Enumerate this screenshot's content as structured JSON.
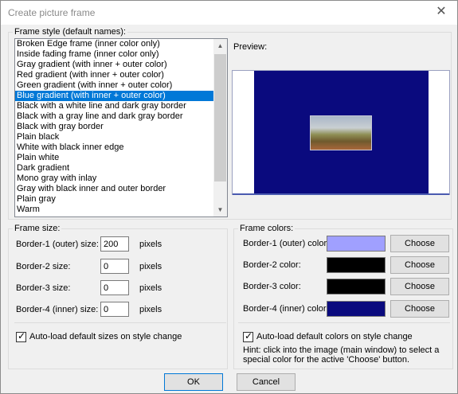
{
  "window": {
    "title": "Create picture frame"
  },
  "frame_style": {
    "legend": "Frame style (default names):",
    "items": [
      "Broken Edge frame (inner color only)",
      "Inside fading frame (inner color only)",
      "Gray gradient (with inner + outer color)",
      "Red gradient (with inner + outer color)",
      "Green gradient (with inner + outer color)",
      "Blue gradient (with inner + outer color)",
      "Black with a white line and dark gray border",
      "Black with a gray line and dark gray border",
      "Black with gray border",
      "Plain black",
      "White with black inner edge",
      "Plain white",
      "Dark gradient",
      "Mono gray with inlay",
      "Gray with black inner and outer border",
      "Plain gray",
      "Warm"
    ],
    "selected_index": 5
  },
  "preview": {
    "label": "Preview:"
  },
  "frame_size": {
    "legend": "Frame size:",
    "unit": "pixels",
    "rows": [
      {
        "label": "Border-1 (outer) size:",
        "value": "200"
      },
      {
        "label": "Border-2 size:",
        "value": "0"
      },
      {
        "label": "Border-3 size:",
        "value": "0"
      },
      {
        "label": "Border-4 (inner) size:",
        "value": "0"
      }
    ],
    "autoload_label": "Auto-load default sizes on style change",
    "autoload_checked": true
  },
  "frame_colors": {
    "legend": "Frame colors:",
    "choose_label": "Choose",
    "rows": [
      {
        "label": "Border-1 (outer) color:",
        "color": "#a0a0ff"
      },
      {
        "label": "Border-2 color:",
        "color": "#000000"
      },
      {
        "label": "Border-3 color:",
        "color": "#000000"
      },
      {
        "label": "Border-4 (inner) color:",
        "color": "#0a0a7e"
      }
    ],
    "autoload_label": "Auto-load default colors on style change",
    "autoload_checked": true,
    "hint": "Hint: click into the image (main window) to select a special color for the active 'Choose' button."
  },
  "buttons": {
    "ok": "OK",
    "cancel": "Cancel"
  }
}
